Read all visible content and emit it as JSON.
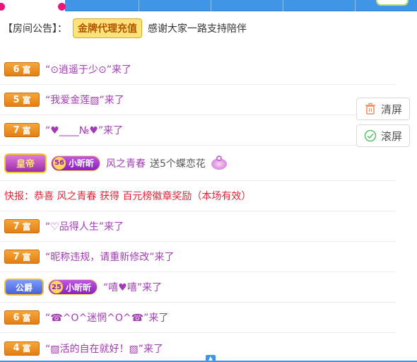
{
  "notice": {
    "label": "【房间公告】：",
    "button_label": "金牌代理充值",
    "message": "感谢大家一路支持陪伴"
  },
  "side": {
    "clear_label": "清屏",
    "scroll_label": "滚屏"
  },
  "messages": [
    {
      "rank_num": "6",
      "rank_text": "富",
      "body": "“⊙逍遥于少⊙”来了"
    },
    {
      "rank_num": "5",
      "rank_text": "富",
      "body": "“我爱金莲▧”来了"
    },
    {
      "rank_num": "7",
      "rank_text": "富",
      "body": "“♥____№♥”来了"
    },
    {
      "badge": "皇帝",
      "fan_level": "56",
      "fan_name": "小昕昕",
      "user": "风之青春",
      "action": "送5个蝶恋花"
    },
    {
      "flash": "快报：恭喜 风之青春 获得 百元榜徽章奖励（本场有效）"
    },
    {
      "rank_num": "7",
      "rank_text": "富",
      "body": "“♡品得人生”来了"
    },
    {
      "rank_num": "7",
      "rank_text": "富",
      "body": "“昵称违规，请重新修改”来了"
    },
    {
      "badge": "公爵",
      "fan_level": "25",
      "fan_name": "小昕昕",
      "body": "“嘻♥嘻”来了"
    },
    {
      "rank_num": "6",
      "rank_text": "富",
      "body": "“☎^O^迷惘^O^☎”来了"
    },
    {
      "rank_num": "4",
      "rank_text": "富",
      "body": "“▨活的自在就好！▨”来了"
    }
  ],
  "colors": {
    "accent_blue": "#3f96e6",
    "rank_orange": "#e17c12",
    "purple_text": "#a23cb3",
    "flash_red": "#e0263a"
  }
}
